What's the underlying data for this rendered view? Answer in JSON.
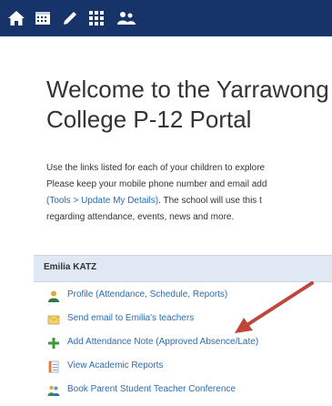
{
  "toolbar": {
    "icons": [
      "home-icon",
      "calendar-icon",
      "pencil-icon",
      "grid-icon",
      "people-icon"
    ]
  },
  "page": {
    "title_line1": "Welcome to the Yarrawong",
    "title_line2": "College P-12 Portal"
  },
  "intro": {
    "line1": "Use the links listed for each of your children to explore",
    "line2": "Please keep your mobile phone number and email add",
    "line3_link": "(Tools > Update My Details)",
    "line3_rest": ". The school will use this t",
    "line4": "regarding attendance, events, news and more."
  },
  "student": {
    "name": "Emilia KATZ",
    "links": [
      {
        "label": "Profile (Attendance, Schedule, Reports)",
        "icon": "profile-icon"
      },
      {
        "label": "Send email to Emilia's teachers",
        "icon": "email-icon"
      },
      {
        "label": "Add Attendance Note (Approved Absence/Late)",
        "icon": "add-icon"
      },
      {
        "label": "View Academic Reports",
        "icon": "report-icon"
      },
      {
        "label": "Book Parent Student Teacher Conference",
        "icon": "conference-icon"
      }
    ]
  },
  "colors": {
    "topbar": "#16346a",
    "link": "#2a6cb0",
    "panel_head": "#dfe8f3",
    "arrow": "#c0453b"
  }
}
